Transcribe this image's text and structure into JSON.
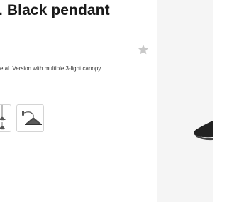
{
  "product": {
    "title": ". Black pendant",
    "description": "etal. Version with multiple 3-light canopy."
  },
  "actions": {
    "favorite_icon": "star-icon"
  },
  "variants": [
    {
      "icon": "pendant-lamp-icon"
    },
    {
      "icon": "wall-lamp-icon"
    }
  ],
  "colors": {
    "title": "#1a1a1a",
    "text": "#333333",
    "star": "#c8c8c8",
    "thumb_border": "#d4d4d4",
    "image_bg": "#f5f5f5",
    "lamp": "#222222"
  }
}
